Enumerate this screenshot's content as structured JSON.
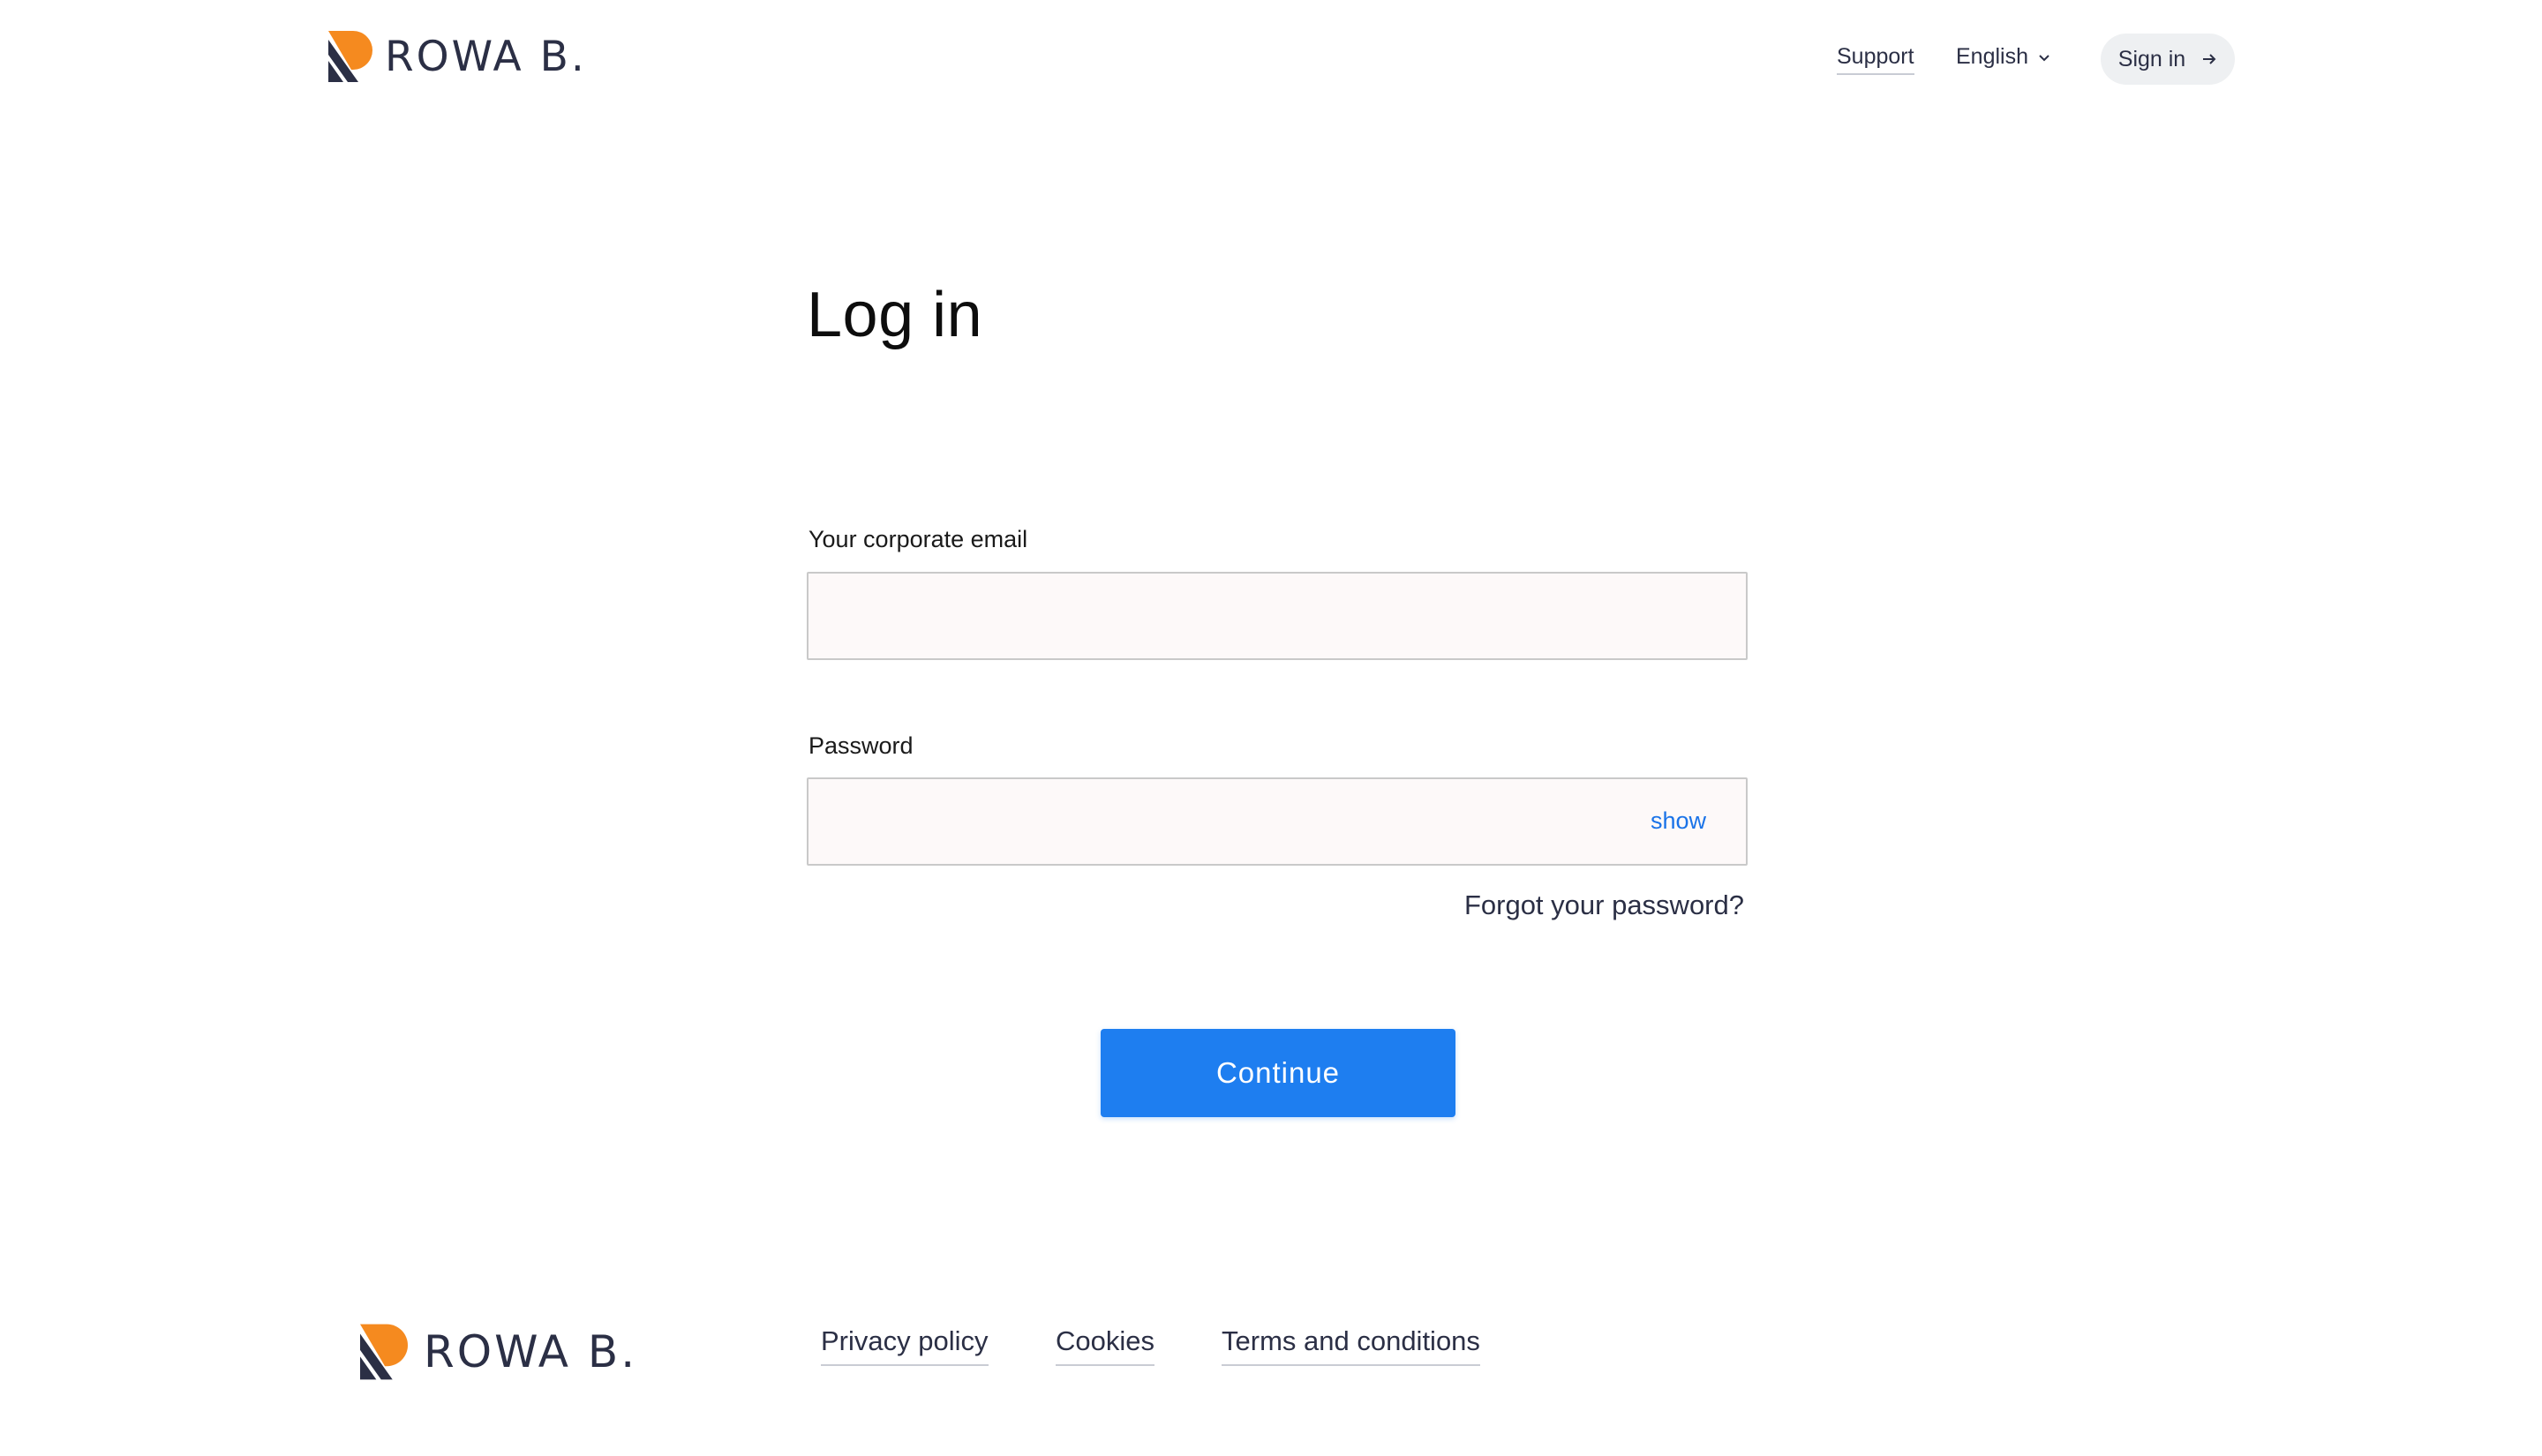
{
  "brand": {
    "name": "ROWA B.",
    "colors": {
      "orange": "#f58a1f",
      "navy": "#2b2f45"
    }
  },
  "header": {
    "nav": {
      "support_label": "Support",
      "language_label": "English",
      "signin_label": "Sign in"
    }
  },
  "main": {
    "title": "Log in",
    "email": {
      "label": "Your corporate email",
      "value": "",
      "placeholder": ""
    },
    "password": {
      "label": "Password",
      "value": "",
      "placeholder": "",
      "toggle_label": "show"
    },
    "forgot_label": "Forgot your password?",
    "continue_label": "Continue",
    "accent_color": "#1e7ef0"
  },
  "footer": {
    "links": [
      "Privacy policy",
      "Cookies",
      "Terms and conditions"
    ]
  },
  "icons": {
    "logo": "rowa-logo-icon",
    "language_dropdown": "chevron-down-icon",
    "signin": "arrow-right-icon"
  }
}
